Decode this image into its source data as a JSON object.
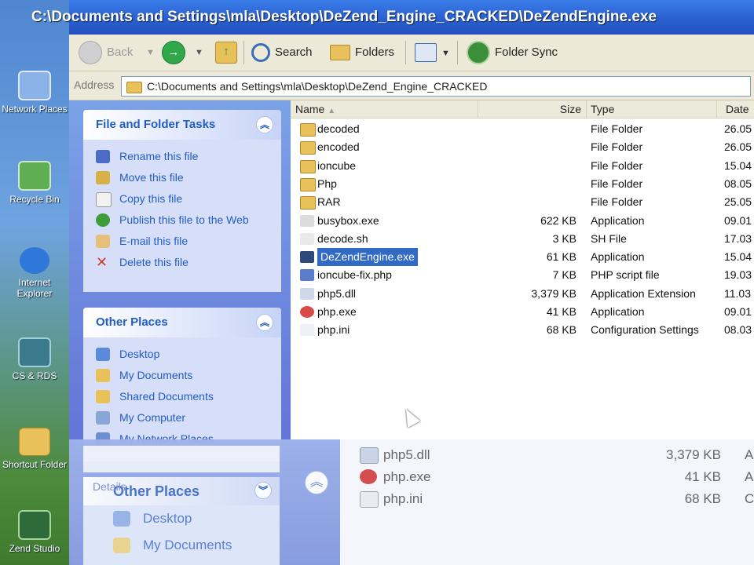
{
  "window": {
    "title": "C:\\Documents and Settings\\mla\\Desktop\\DeZend_Engine_CRACKED\\DeZendEngine.exe"
  },
  "toolbar": {
    "back": "Back",
    "search": "Search",
    "folders": "Folders",
    "folder_sync": "Folder Sync"
  },
  "address": {
    "label": "Address",
    "path": "C:\\Documents and Settings\\mla\\Desktop\\DeZend_Engine_CRACKED"
  },
  "desktop_icons": [
    {
      "label": "Network Places",
      "icon": "network-places-icon"
    },
    {
      "label": "Recycle Bin",
      "icon": "recycle-bin-icon"
    },
    {
      "label": "Internet Explorer",
      "icon": "internet-explorer-icon"
    },
    {
      "label": "CS & RDS",
      "icon": "network-icon"
    },
    {
      "label": "Shortcut Folder",
      "icon": "folder-icon"
    },
    {
      "label": "Zend Studio",
      "icon": "zend-icon"
    }
  ],
  "file_tasks": {
    "title": "File and Folder Tasks",
    "items": [
      {
        "label": "Rename this file",
        "icon": "rename-icon",
        "color": "#4a6cc4"
      },
      {
        "label": "Move this file",
        "icon": "move-icon",
        "color": "#d8b04a"
      },
      {
        "label": "Copy this file",
        "icon": "copy-icon",
        "color": "#f2f2f2"
      },
      {
        "label": "Publish this file to the Web",
        "icon": "globe-icon",
        "color": "#3f9c3a"
      },
      {
        "label": "E-mail this file",
        "icon": "email-icon",
        "color": "#e4c07a"
      },
      {
        "label": "Delete this file",
        "icon": "delete-icon",
        "color": "#d23a2a"
      }
    ]
  },
  "other_places": {
    "title": "Other Places",
    "items": [
      {
        "label": "Desktop",
        "icon": "desktop-icon",
        "color": "#5a8ad8"
      },
      {
        "label": "My Documents",
        "icon": "folder-icon",
        "color": "#e8c15a"
      },
      {
        "label": "Shared Documents",
        "icon": "folder-icon",
        "color": "#e8c15a"
      },
      {
        "label": "My Computer",
        "icon": "computer-icon",
        "color": "#8aa6d6"
      },
      {
        "label": "My Network Places",
        "icon": "network-icon",
        "color": "#6b8fd0"
      }
    ]
  },
  "columns": {
    "name": "Name",
    "size": "Size",
    "type": "Type",
    "date": "Date"
  },
  "files": [
    {
      "name": "decoded",
      "size": "",
      "type": "File Folder",
      "date": "26.05",
      "icon": "folder-icon"
    },
    {
      "name": "encoded",
      "size": "",
      "type": "File Folder",
      "date": "26.05",
      "icon": "folder-icon"
    },
    {
      "name": "ioncube",
      "size": "",
      "type": "File Folder",
      "date": "15.04",
      "icon": "folder-icon"
    },
    {
      "name": "Php",
      "size": "",
      "type": "File Folder",
      "date": "08.05",
      "icon": "folder-icon"
    },
    {
      "name": "RAR",
      "size": "",
      "type": "File Folder",
      "date": "25.05",
      "icon": "folder-icon"
    },
    {
      "name": "busybox.exe",
      "size": "622 KB",
      "type": "Application",
      "date": "09.01",
      "icon": "app-icon"
    },
    {
      "name": "decode.sh",
      "size": "3 KB",
      "type": "SH File",
      "date": "17.03",
      "icon": "script-icon"
    },
    {
      "name": "DeZendEngine.exe",
      "size": "61 KB",
      "type": "Application",
      "date": "15.04",
      "icon": "zend-icon",
      "selected": true
    },
    {
      "name": "ioncube-fix.php",
      "size": "7 KB",
      "type": "PHP script file",
      "date": "19.03",
      "icon": "php-icon"
    },
    {
      "name": "php5.dll",
      "size": "3,379 KB",
      "type": "Application Extension",
      "date": "11.03",
      "icon": "dll-icon"
    },
    {
      "name": "php.exe",
      "size": "41 KB",
      "type": "Application",
      "date": "09.01",
      "icon": "php-exe-icon"
    },
    {
      "name": "php.ini",
      "size": "68 KB",
      "type": "Configuration Settings",
      "date": "08.03",
      "icon": "ini-icon"
    }
  ],
  "ghost": {
    "pane_title": "Other Places",
    "pane_subtitle": "Details",
    "items": [
      "Desktop",
      "My Documents"
    ],
    "files": [
      {
        "name": "php5.dll",
        "size": "3,379 KB",
        "type": "Appli"
      },
      {
        "name": "php.exe",
        "size": "41 KB",
        "type": "Appli"
      },
      {
        "name": "php.ini",
        "size": "68 KB",
        "type": "Conf"
      }
    ]
  }
}
